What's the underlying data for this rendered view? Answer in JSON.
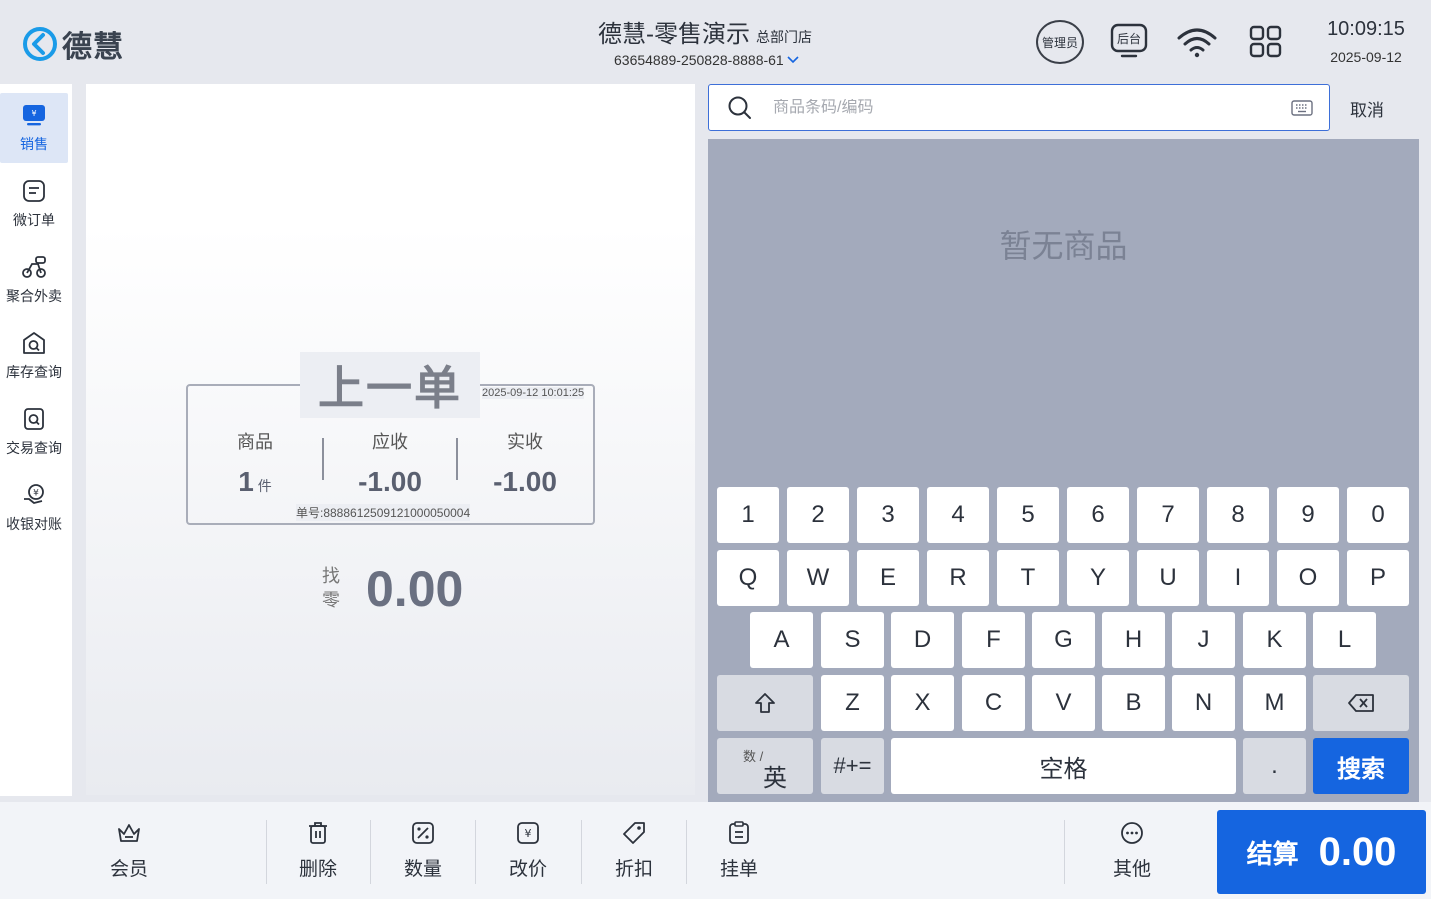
{
  "header": {
    "logo_text": "德慧",
    "store_name": "德慧-零售演示",
    "store_type": "总部门店",
    "device_code": "63654889-250828-8888-61",
    "admin_label": "管理员",
    "backend_label": "后台",
    "time": "10:09:15",
    "date": "2025-09-12"
  },
  "sidebar": {
    "items": [
      {
        "label": "销售",
        "icon": "sales-icon"
      },
      {
        "label": "微订单",
        "icon": "micro-order-icon"
      },
      {
        "label": "聚合外卖",
        "icon": "delivery-icon"
      },
      {
        "label": "库存查询",
        "icon": "inventory-search-icon"
      },
      {
        "label": "交易查询",
        "icon": "transaction-search-icon"
      },
      {
        "label": "收银对账",
        "icon": "reconciliation-icon"
      }
    ]
  },
  "last_order": {
    "title": "上一单",
    "time": "2025-09-12 10:01:25",
    "goods_label": "商品",
    "goods_count": "1",
    "goods_unit": "件",
    "receivable_label": "应收",
    "receivable": "-1.00",
    "paid_label": "实收",
    "paid": "-1.00",
    "order_no": "单号:888861250912100005000​4",
    "change_label": "找零",
    "change": "0.00"
  },
  "search": {
    "placeholder": "商品条码/编码",
    "cancel_label": "取消"
  },
  "goods": {
    "empty_text": "暂无商品"
  },
  "keyboard": {
    "row1": [
      "1",
      "2",
      "3",
      "4",
      "5",
      "6",
      "7",
      "8",
      "9",
      "0"
    ],
    "row2": [
      "Q",
      "W",
      "E",
      "R",
      "T",
      "Y",
      "U",
      "I",
      "O",
      "P"
    ],
    "row3": [
      "A",
      "S",
      "D",
      "F",
      "G",
      "H",
      "J",
      "K",
      "L"
    ],
    "row4": [
      "Z",
      "X",
      "C",
      "V",
      "B",
      "N",
      "M"
    ],
    "mode_small": "数 /",
    "mode_big": "英",
    "symbols": "#+=",
    "space": "空格",
    "dot": ".",
    "search": "搜索"
  },
  "toolbar": {
    "member": "会员",
    "delete": "删除",
    "quantity": "数量",
    "change_price": "改价",
    "discount": "折扣",
    "hold": "挂单",
    "other": "其他",
    "checkout_label": "结算",
    "checkout_amount": "0.00"
  },
  "colors": {
    "accent": "#1565e0",
    "goods_bg": "#a3aabc",
    "page_bg": "#e6e8ee"
  }
}
